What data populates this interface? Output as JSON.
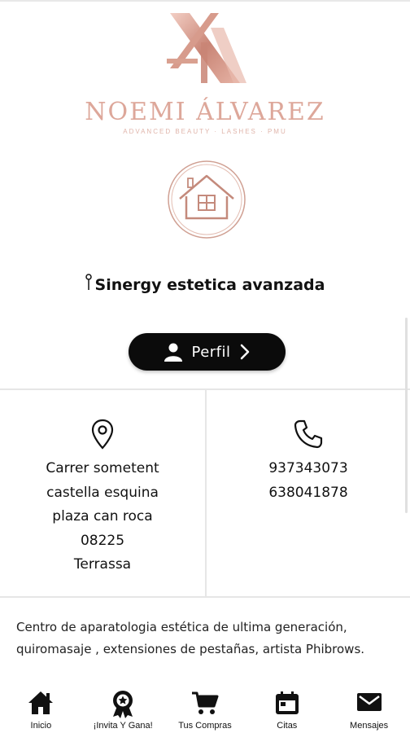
{
  "brand": {
    "name": "NOEMI ÁLVAREZ",
    "tagline": "ADVANCED BEAUTY · LASHES · PMU",
    "logo_color": "#dda79a"
  },
  "location": {
    "name": "Sinergy estetica avanzada"
  },
  "profile_button": {
    "label": "Perfil"
  },
  "address": {
    "icon": "map-pin-icon",
    "lines": [
      "Carrer sometent",
      "castella esquina",
      "plaza can roca",
      "08225",
      "Terrassa"
    ]
  },
  "phones": {
    "icon": "phone-icon",
    "lines": [
      "937343073",
      "638041878"
    ]
  },
  "description": "Centro de aparatologia estética de ultima generación, quiromasaje , extensiones de pestañas, artista Phibrows.",
  "nav": {
    "items": [
      {
        "label": "Inicio",
        "icon": "home-icon"
      },
      {
        "label": "¡Invita Y Gana!",
        "icon": "award-icon"
      },
      {
        "label": "Tus Compras",
        "icon": "cart-icon"
      },
      {
        "label": "Citas",
        "icon": "calendar-icon"
      },
      {
        "label": "Mensajes",
        "icon": "mail-icon"
      }
    ]
  }
}
